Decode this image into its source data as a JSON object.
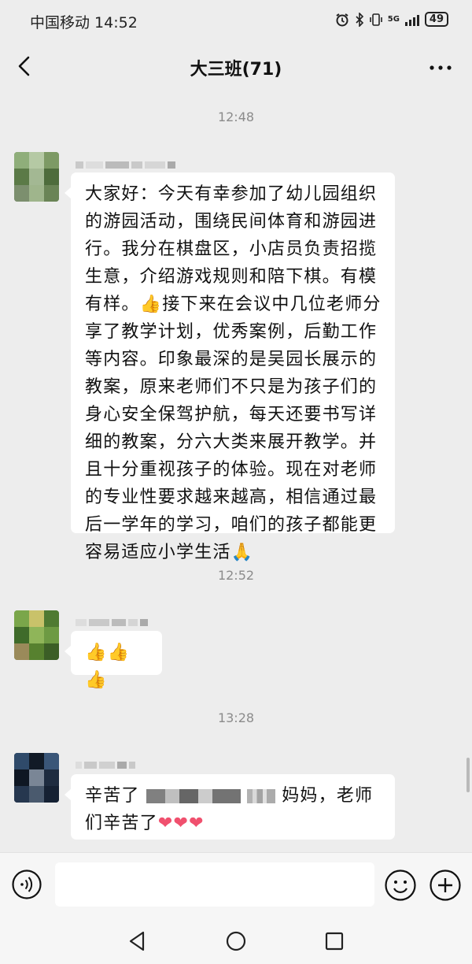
{
  "status_bar": {
    "carrier_time": "中国移动 14:52",
    "network": "5G",
    "battery": "49"
  },
  "nav": {
    "title": "大三班(71)",
    "more_label": "···"
  },
  "messages": [
    {
      "time": "12:48",
      "text": "大家好：今天有幸参加了幼儿园组织的游园活动，围绕民间体育和游园进行。我分在棋盘区，小店员负责招揽生意，介绍游戏规则和陪下棋。有模有样。",
      "emoji_1": "👍",
      "text_2": "接下来在会议中几位老师分享了教学计划，优秀案例，后勤工作等内容。印象最深的是吴园长展示的教案，原来老师们不只是为孩子们的身心安全保驾护航，每天还要书写详细的教案，分六大类来展开教学。并且十分重视孩子的体验。现在对老师的专业性要求越来越高，相信通过最后一学年的学习，咱们的孩子都能更容易适应小学生活",
      "emoji_2": "🙏"
    },
    {
      "time": "12:52",
      "emoji": "👍👍👍"
    },
    {
      "time": "13:28",
      "text_a": "辛苦了",
      "text_b": "妈妈，老师们辛苦了",
      "emoji": "❤❤❤"
    }
  ],
  "input": {
    "placeholder": ""
  }
}
